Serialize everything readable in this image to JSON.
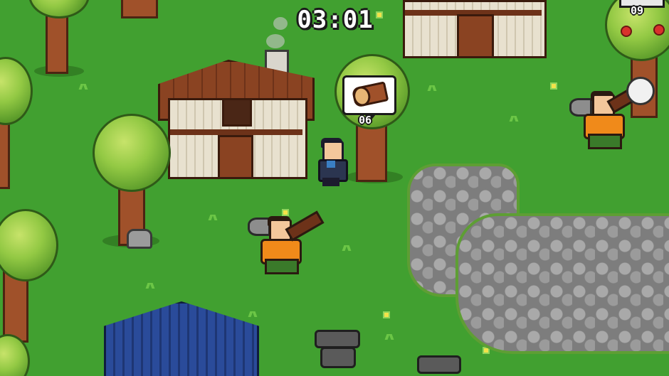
{
  "hud": {
    "timer": "03:01",
    "log_icon": "wood-log-icon",
    "log_count": "06",
    "corner_counter": "09"
  },
  "colors": {
    "grass": "#41a030",
    "stone": "#7d7d7d",
    "roof": "#8a4322",
    "lumberjack_shirt": "#f08a1a",
    "player_scarf": "#3a7fc4",
    "container_roof": "#2a4b9a"
  }
}
